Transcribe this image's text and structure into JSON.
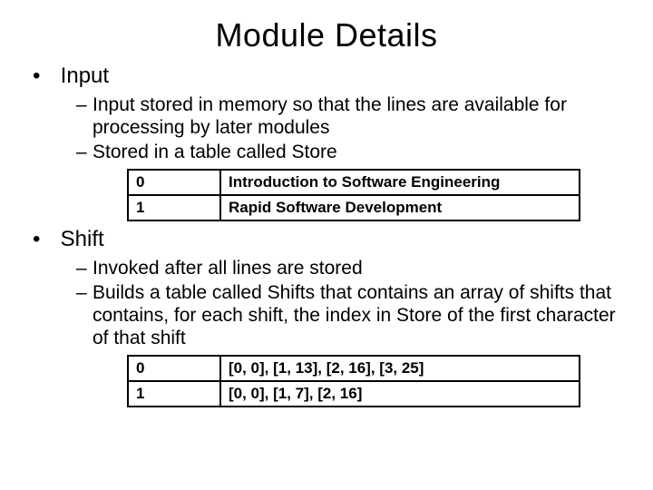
{
  "title": "Module Details",
  "sections": [
    {
      "heading": "Input",
      "bullets": [
        "Input stored in memory so that the lines are available for processing by later modules",
        "Stored in a table called Store"
      ],
      "table": [
        {
          "index": "0",
          "value": "Introduction to Software Engineering"
        },
        {
          "index": "1",
          "value": "Rapid Software Development"
        }
      ]
    },
    {
      "heading": "Shift",
      "bullets": [
        "Invoked after all lines are stored",
        "Builds a table called Shifts that contains an array of shifts that contains, for each shift, the index in Store of the first character of that shift"
      ],
      "table": [
        {
          "index": "0",
          "value": "[0, 0], [1, 13], [2, 16], [3, 25]"
        },
        {
          "index": "1",
          "value": "[0, 0], [1, 7], [2, 16]"
        }
      ]
    }
  ]
}
